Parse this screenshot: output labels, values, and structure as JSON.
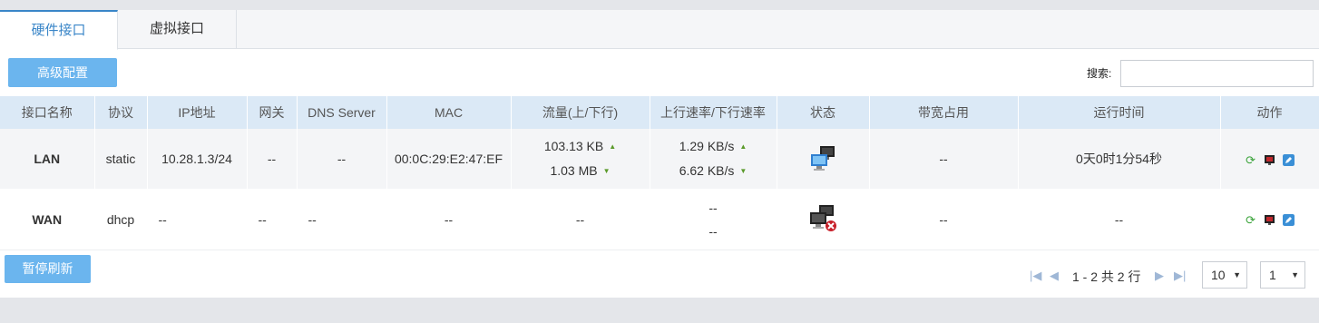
{
  "tabs": [
    {
      "label": "硬件接口",
      "active": true
    },
    {
      "label": "虚拟接口",
      "active": false
    }
  ],
  "toolbar": {
    "advanced_label": "高级配置"
  },
  "search": {
    "label": "搜索:",
    "value": "",
    "placeholder": ""
  },
  "table": {
    "headers": [
      "接口名称",
      "协议",
      "IP地址",
      "网关",
      "DNS Server",
      "MAC",
      "流量(上/下行)",
      "上行速率/下行速率",
      "状态",
      "带宽占用",
      "运行时间",
      "动作"
    ],
    "rows": [
      {
        "name": "LAN",
        "protocol": "static",
        "ip": "10.28.1.3/24",
        "gateway": "--",
        "dns": "--",
        "mac": "00:0C:29:E2:47:EF",
        "traffic_up": "103.13 KB",
        "traffic_down": "1.03 MB",
        "rate_up": "1.29 KB/s",
        "rate_down": "6.62 KB/s",
        "status": "connected",
        "bandwidth": "--",
        "uptime": "0天0时1分54秒"
      },
      {
        "name": "WAN",
        "protocol": "dhcp",
        "ip": "--",
        "gateway": "--",
        "dns": "--",
        "mac": "--",
        "traffic": "--",
        "rate_up": "--",
        "rate_down": "--",
        "status": "disconnected",
        "bandwidth": "--",
        "uptime": "--"
      }
    ]
  },
  "footer": {
    "pause_label": "暂停刷新",
    "page_info": "1 - 2 共 2 行",
    "page_size": "10",
    "page": "1"
  },
  "colors": {
    "accent": "#3a86c8",
    "button": "#6bb5ee",
    "header_bg": "#dbe9f6"
  }
}
